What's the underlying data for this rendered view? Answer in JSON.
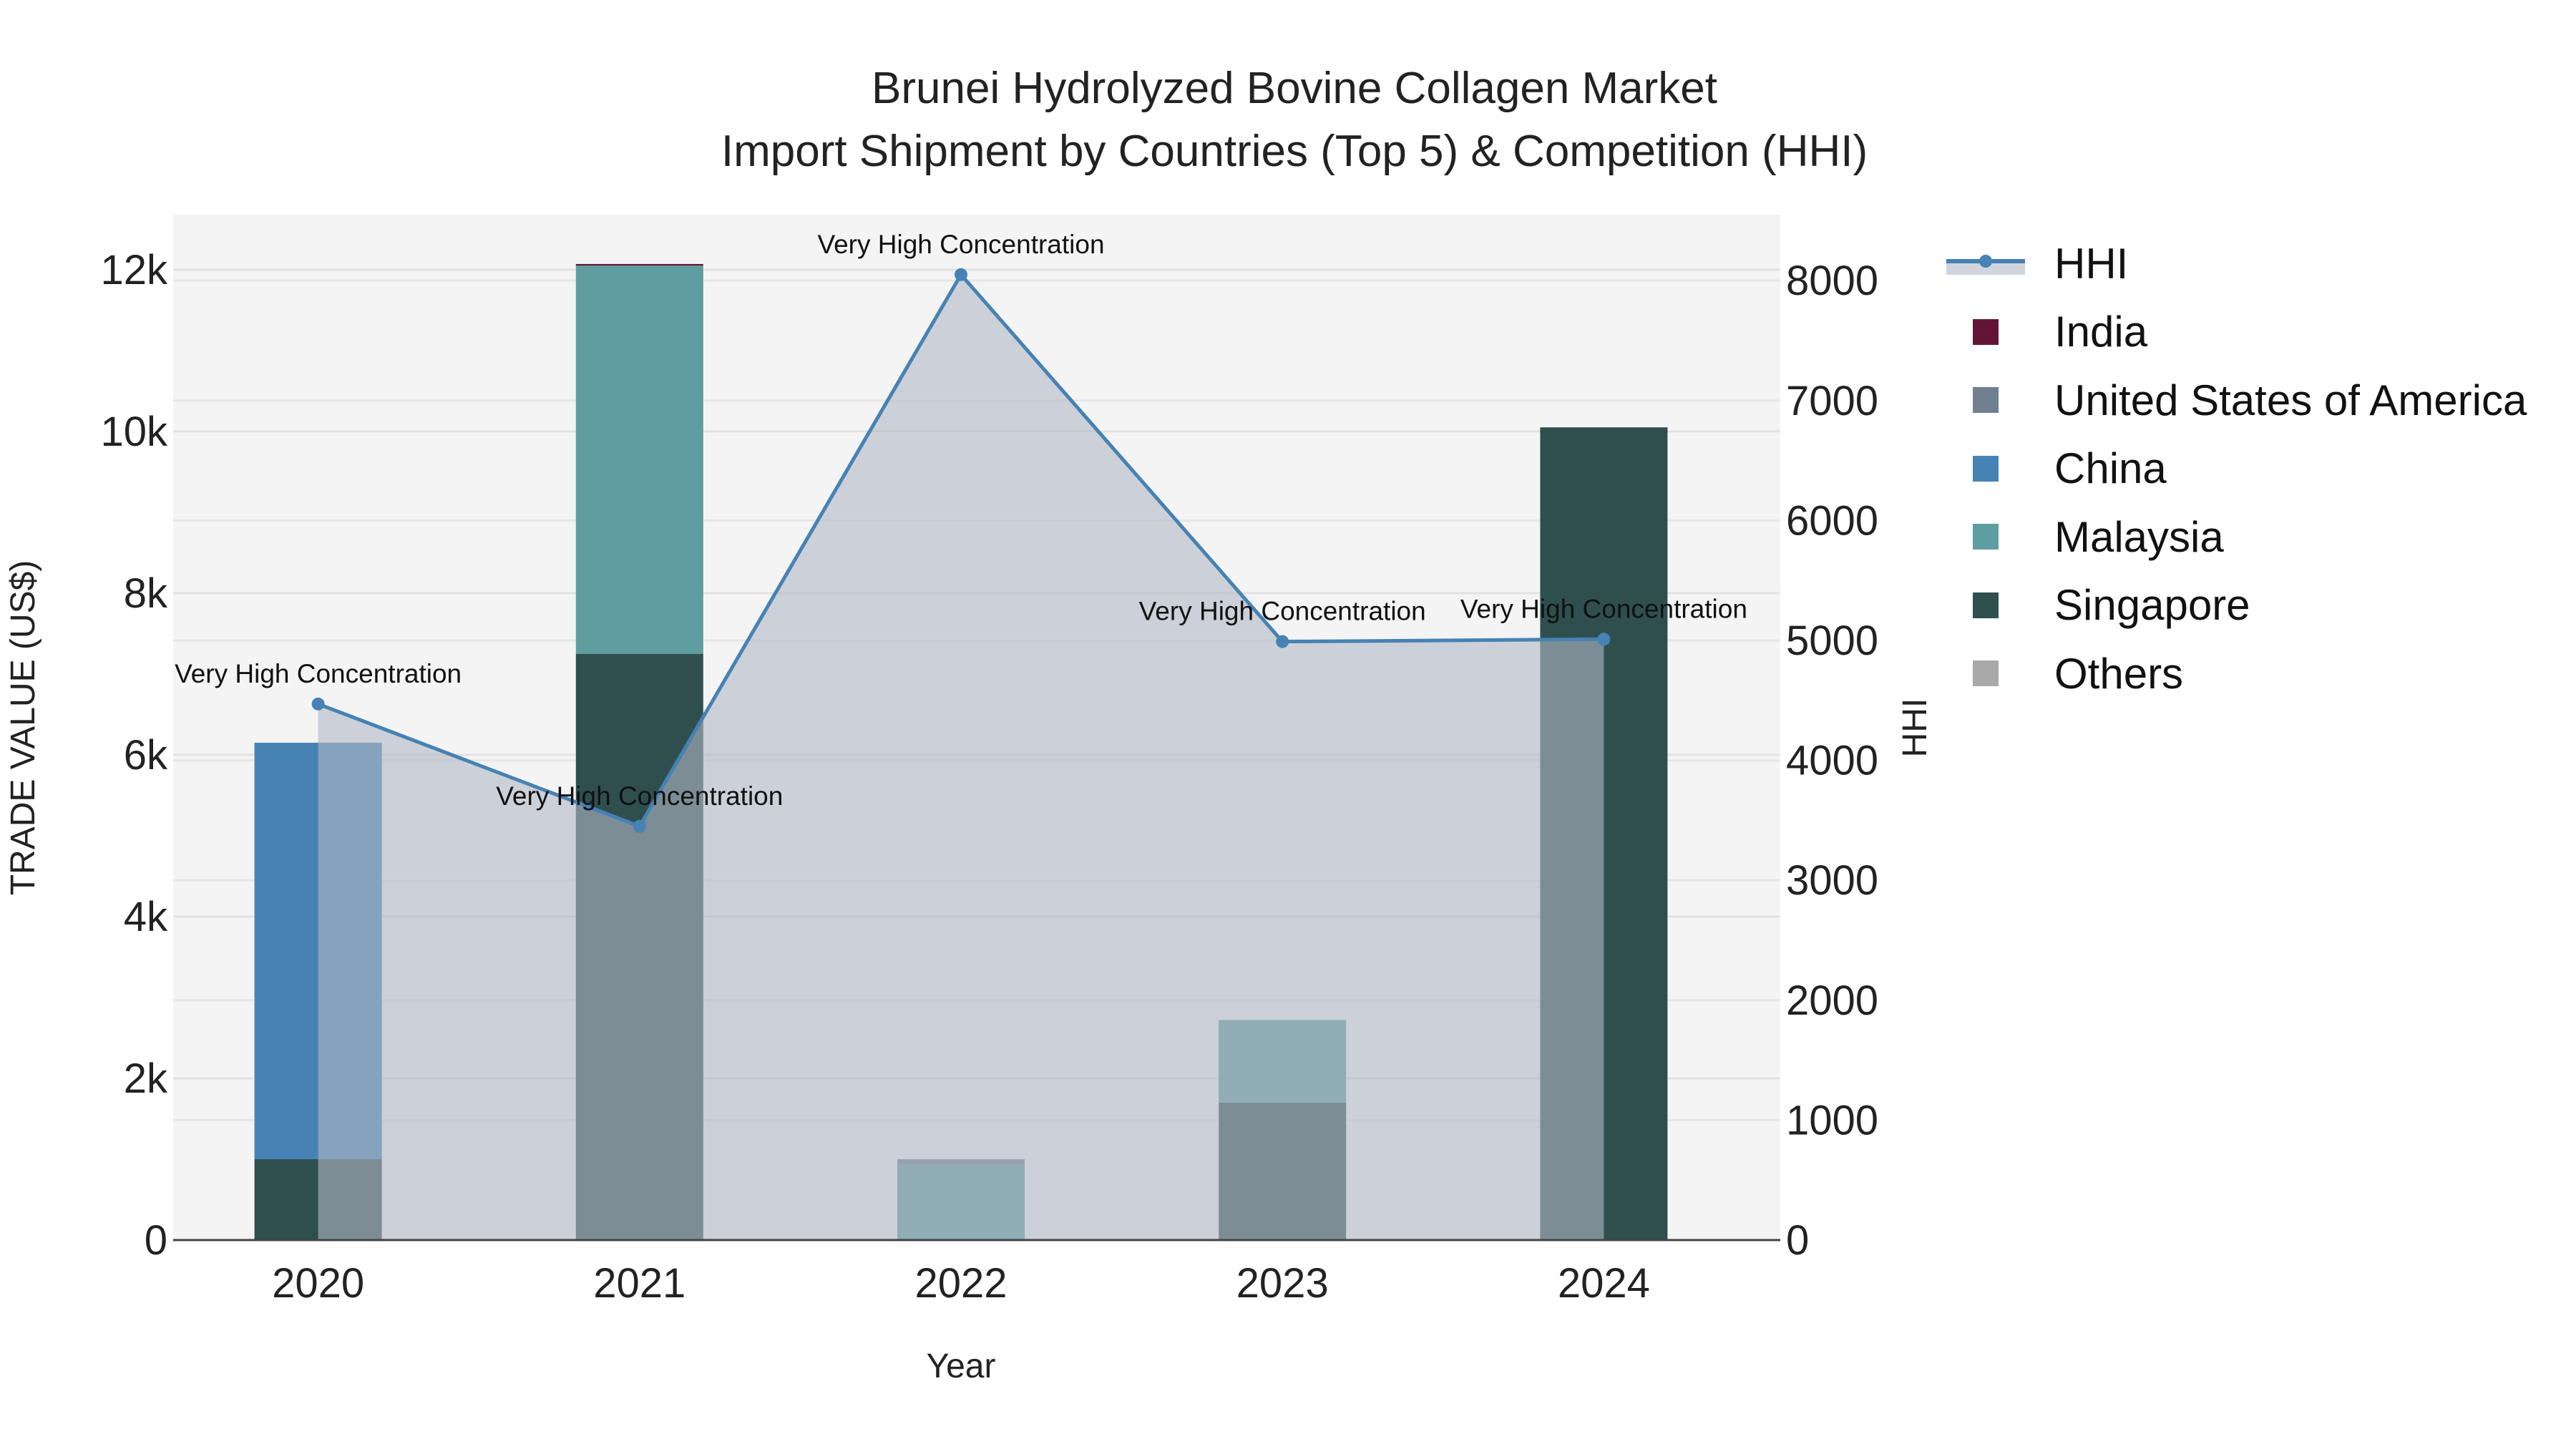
{
  "chart_data": {
    "type": "bar",
    "title": "Brunei Hydrolyzed Bovine Collagen Market",
    "subtitle": "Import Shipment by Countries (Top 5) & Competition (HHI)",
    "xlabel": "Year",
    "ylabel": "TRADE VALUE (US$)",
    "y2label": "HHI",
    "barmode": "stack",
    "categories": [
      "2020",
      "2021",
      "2022",
      "2023",
      "2024"
    ],
    "ylim": [
      0,
      12680
    ],
    "yticks": [
      0,
      2000,
      4000,
      6000,
      8000,
      10000,
      12000
    ],
    "ytick_labels": [
      "0",
      "2k",
      "4k",
      "6k",
      "8k",
      "10k",
      "12k"
    ],
    "y2lim": [
      0,
      8550
    ],
    "y2ticks": [
      0,
      1000,
      2000,
      3000,
      4000,
      5000,
      6000,
      7000,
      8000
    ],
    "y2tick_labels": [
      "0",
      "1000",
      "2000",
      "3000",
      "4000",
      "5000",
      "6000",
      "7000",
      "8000"
    ],
    "grid": true,
    "legend_position": "right",
    "series": [
      {
        "name": "Singapore",
        "color": "#2f4f4f",
        "values": [
          1000,
          7250,
          0,
          1700,
          10050
        ]
      },
      {
        "name": "Malaysia",
        "color": "#5f9ea0",
        "values": [
          0,
          4800,
          930,
          1020,
          0
        ]
      },
      {
        "name": "China",
        "color": "#4682b4",
        "values": [
          5150,
          0,
          0,
          0,
          0
        ]
      },
      {
        "name": "United States of America",
        "color": "#708090",
        "values": [
          0,
          0,
          70,
          0,
          0
        ]
      },
      {
        "name": "India",
        "color": "#641436",
        "values": [
          0,
          20,
          0,
          0,
          0
        ]
      },
      {
        "name": "Others",
        "color": "#a9a9a9",
        "values": [
          0,
          0,
          0,
          0,
          0
        ]
      }
    ],
    "legend_order": [
      "India",
      "United States of America",
      "China",
      "Malaysia",
      "Singapore",
      "Others"
    ],
    "hhi": {
      "name": "HHI",
      "type": "line-area",
      "color": "#4682b4",
      "fill_color": "#b0b8c4",
      "values": [
        4470,
        3450,
        8050,
        4990,
        5010
      ],
      "annotations": [
        "Very High Concentration",
        "Very High Concentration",
        "Very High Concentration",
        "Very High Concentration",
        "Very High Concentration"
      ]
    },
    "plot_background": "#f4f4f4"
  }
}
